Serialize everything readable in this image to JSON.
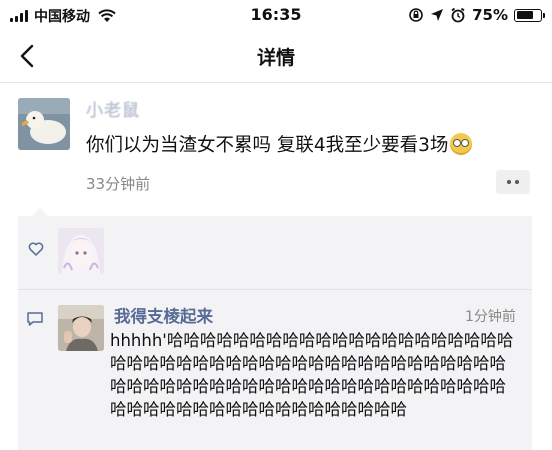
{
  "status_bar": {
    "carrier": "中国移动",
    "time": "16:35",
    "battery_pct": "75%",
    "battery_level": 0.75,
    "icons": [
      "signal-icon",
      "wifi-icon",
      "rotation-lock-icon",
      "location-icon",
      "alarm-icon",
      "battery-icon"
    ]
  },
  "nav": {
    "title": "详情",
    "back_icon": "chevron-left-icon"
  },
  "post": {
    "username": "小老鼠",
    "text": "你们以为当渣女不累吗 复联4我至少要看3场",
    "emoji": "grinning-face-icon",
    "time": "33分钟前",
    "more_icon": "more-dots-icon"
  },
  "likes": {
    "icon": "heart-icon"
  },
  "comments": [
    {
      "name": "我得支棱起来",
      "time": "1分钟前",
      "text": "hhhhh'哈哈哈哈哈哈哈哈哈哈哈哈哈哈哈哈哈哈哈哈哈哈哈哈哈哈哈哈哈哈哈哈哈哈哈哈哈哈哈哈哈哈哈哈哈哈哈哈哈哈哈哈哈哈哈哈哈哈哈哈哈哈哈哈哈哈哈哈哈哈哈哈哈哈哈哈哈哈哈哈哈哈哈哈哈哈哈"
    }
  ],
  "colors": {
    "link_blue": "#576b95",
    "panel_bg": "#f3f3f5",
    "secondary_text": "#888888"
  }
}
